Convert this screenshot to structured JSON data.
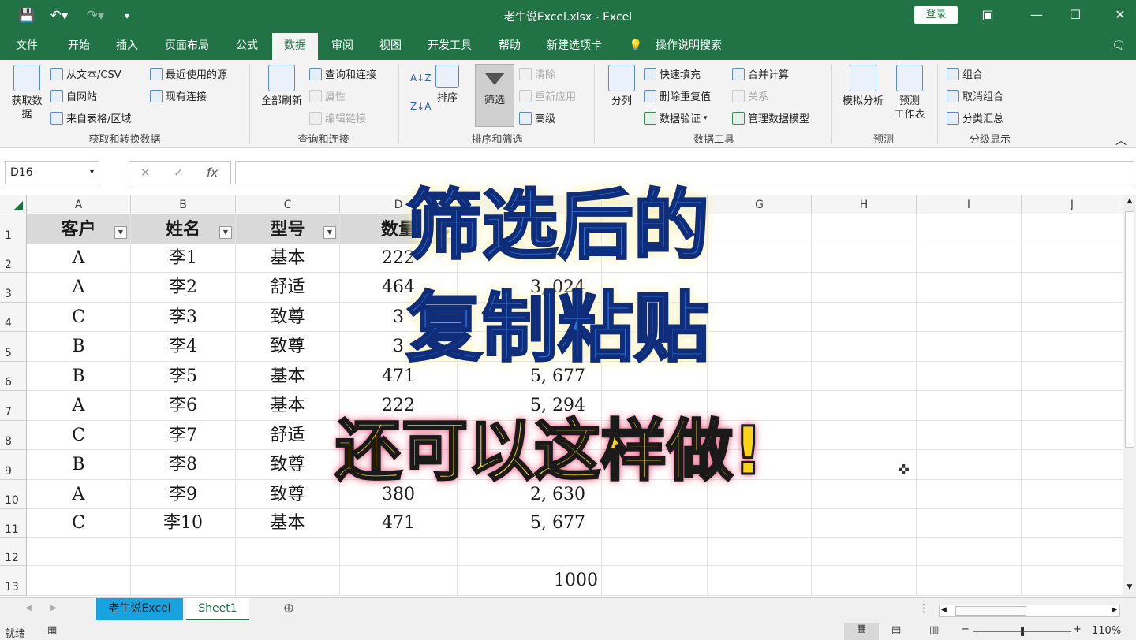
{
  "app": {
    "title": "老牛说Excel.xlsx  -  Excel",
    "login": "登录"
  },
  "tabs": [
    "文件",
    "开始",
    "插入",
    "页面布局",
    "公式",
    "数据",
    "审阅",
    "视图",
    "开发工具",
    "帮助",
    "新建选项卡",
    "操作说明搜索"
  ],
  "ribbon": {
    "get_data": "获取数\n据",
    "from_text": "从文本/CSV",
    "from_web": "自网站",
    "from_table": "来自表格/区域",
    "recent": "最近使用的源",
    "existing": "现有连接",
    "group1": "获取和转换数据",
    "refresh_all": "全部刷新",
    "queries": "查询和连接",
    "properties": "属性",
    "edit_links": "编辑链接",
    "group2": "查询和连接",
    "sort_az": "A↓Z",
    "sort": "排序",
    "filter": "筛选",
    "clear": "清除",
    "reapply": "重新应用",
    "advanced": "高级",
    "group3": "排序和筛选",
    "split": "分列",
    "flash_fill": "快速填充",
    "remove_dup": "删除重复值",
    "validation": "数据验证",
    "consolidate": "合并计算",
    "relations": "关系",
    "data_model": "管理数据模型",
    "group4": "数据工具",
    "whatif": "模拟分析",
    "forecast": "预测\n工作表",
    "group5": "预测",
    "group_btn": "组合",
    "ungroup": "取消组合",
    "subtotal": "分类汇总",
    "group6": "分级显示"
  },
  "namebox": "D16",
  "fx": "fx",
  "columns": [
    "A",
    "B",
    "C",
    "D",
    "E",
    "F",
    "G",
    "H",
    "I",
    "J"
  ],
  "rows": [
    "1",
    "2",
    "3",
    "4",
    "5",
    "6",
    "7",
    "8",
    "9",
    "10",
    "11",
    "12",
    "13"
  ],
  "table": {
    "headers": [
      "客户",
      "姓名",
      "型号",
      "数量"
    ],
    "data": [
      [
        "A",
        "李1",
        "基本",
        "222",
        ""
      ],
      [
        "A",
        "李2",
        "舒适",
        "464",
        "3, 024"
      ],
      [
        "C",
        "李3",
        "致尊",
        "3",
        ""
      ],
      [
        "B",
        "李4",
        "致尊",
        "3",
        ""
      ],
      [
        "B",
        "李5",
        "基本",
        "471",
        "5, 677"
      ],
      [
        "A",
        "李6",
        "基本",
        "222",
        "5, 294"
      ],
      [
        "C",
        "李7",
        "舒适",
        "",
        ""
      ],
      [
        "B",
        "李8",
        "致尊",
        "",
        ""
      ],
      [
        "A",
        "李9",
        "致尊",
        "380",
        "2, 630"
      ],
      [
        "C",
        "李10",
        "基本",
        "471",
        "5, 677"
      ]
    ],
    "e13": "1000"
  },
  "overlay": {
    "line1": "筛选后的",
    "line2": "复制粘贴",
    "line3": "还可以这样做!"
  },
  "sheets": [
    "老牛说Excel",
    "Sheet1"
  ],
  "status": {
    "ready": "就绪",
    "zoom": "110%"
  }
}
